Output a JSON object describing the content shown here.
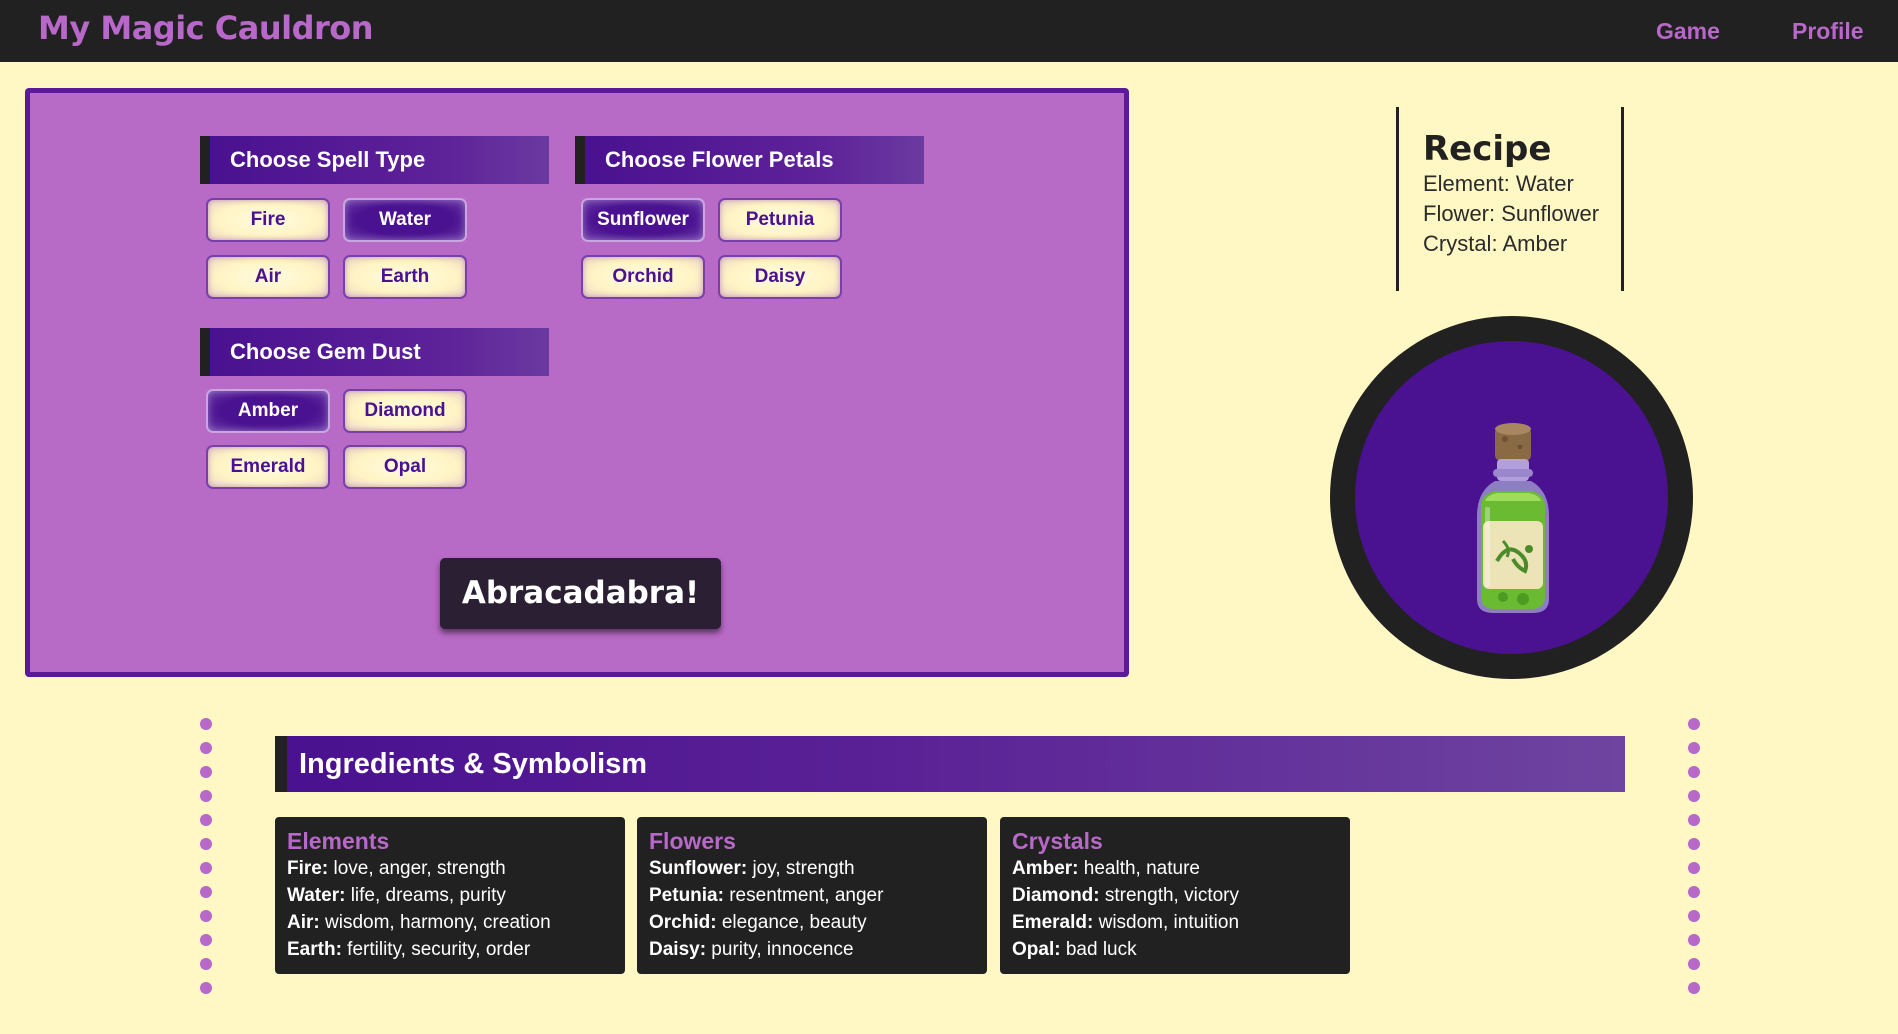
{
  "nav": {
    "brand": "My Magic Cauldron",
    "links": [
      "Game",
      "Profile"
    ]
  },
  "colors": {
    "nav_bg": "#212121",
    "accent": "#b868c8",
    "deep_purple": "#4a1190",
    "page_bg": "#fff8c4",
    "panel_bg": "#b86ac7"
  },
  "spell_panel": {
    "spell_type": {
      "title": "Choose Spell Type",
      "options": [
        "Fire",
        "Water",
        "Air",
        "Earth"
      ],
      "selected": "Water"
    },
    "flower_petals": {
      "title": "Choose Flower Petals",
      "options": [
        "Sunflower",
        "Petunia",
        "Orchid",
        "Daisy"
      ],
      "selected": "Sunflower"
    },
    "gem_dust": {
      "title": "Choose Gem Dust",
      "options": [
        "Amber",
        "Diamond",
        "Emerald",
        "Opal"
      ],
      "selected": "Amber"
    },
    "cast_button": "Abracadabra!"
  },
  "recipe": {
    "title": "Recipe",
    "lines": [
      "Element: Water",
      "Flower: Sunflower",
      "Crystal: Amber"
    ]
  },
  "cauldron": {
    "icon": "potion-bottle-icon"
  },
  "ingredients": {
    "title": "Ingredients & Symbolism",
    "cards": [
      {
        "title": "Elements",
        "rows": [
          {
            "k": "Fire:",
            "v": " love, anger, strength"
          },
          {
            "k": "Water:",
            "v": " life, dreams, purity"
          },
          {
            "k": "Air:",
            "v": " wisdom, harmony, creation"
          },
          {
            "k": "Earth:",
            "v": " fertility, security, order"
          }
        ]
      },
      {
        "title": "Flowers",
        "rows": [
          {
            "k": "Sunflower:",
            "v": " joy, strength"
          },
          {
            "k": "Petunia:",
            "v": " resentment, anger"
          },
          {
            "k": "Orchid:",
            "v": " elegance, beauty"
          },
          {
            "k": "Daisy:",
            "v": " purity, innocence"
          }
        ]
      },
      {
        "title": "Crystals",
        "rows": [
          {
            "k": "Amber:",
            "v": " health, nature"
          },
          {
            "k": "Diamond:",
            "v": " strength, victory"
          },
          {
            "k": "Emerald:",
            "v": " wisdom, intuition"
          },
          {
            "k": "Opal:",
            "v": " bad luck"
          }
        ]
      }
    ]
  }
}
